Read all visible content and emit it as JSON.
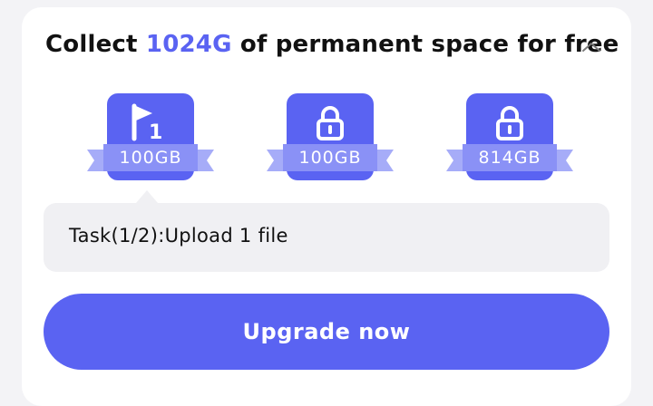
{
  "card": {
    "title_prefix": "Collect ",
    "title_highlight": "1024G",
    "title_suffix": " of permanent space for free",
    "collapse_icon": "chevron-up-icon"
  },
  "rewards": [
    {
      "label": "100GB",
      "icon": "flag-icon",
      "step": "1",
      "state": "current"
    },
    {
      "label": "100GB",
      "icon": "lock-icon",
      "state": "locked"
    },
    {
      "label": "814GB",
      "icon": "lock-icon",
      "state": "locked"
    }
  ],
  "task": {
    "text": "Task(1/2):Upload 1 file"
  },
  "actions": {
    "upgrade_label": "Upgrade now"
  },
  "colors": {
    "accent": "#5a63f2",
    "ribbon": "#8a91f6",
    "panel": "#f0f0f3"
  }
}
